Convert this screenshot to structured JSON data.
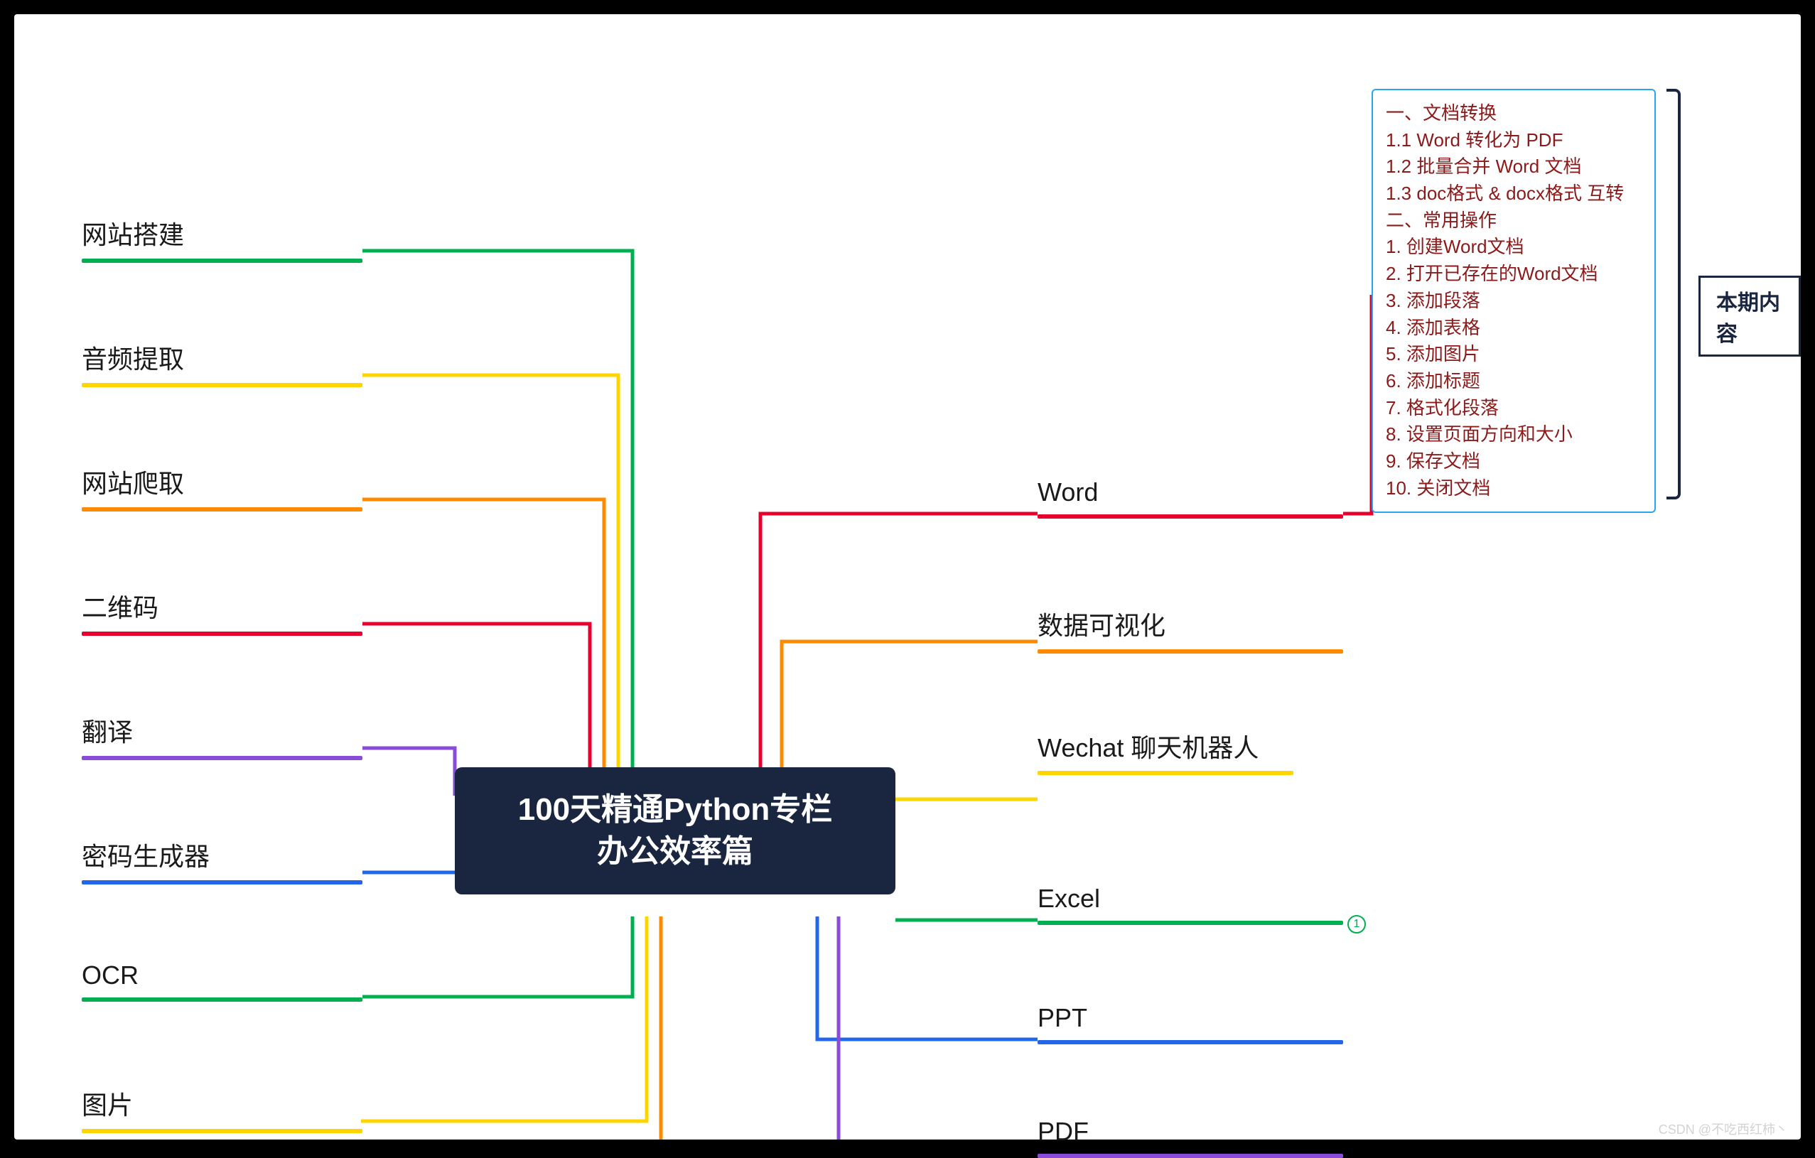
{
  "central": {
    "line1": "100天精通Python专栏",
    "line2": "办公效率篇"
  },
  "left_nodes": [
    {
      "label": "网站搭建",
      "color": "#00b050"
    },
    {
      "label": "音频提取",
      "color": "#ffd500"
    },
    {
      "label": "网站爬取",
      "color": "#ff8a00"
    },
    {
      "label": "二维码",
      "color": "#e6002e"
    },
    {
      "label": "翻译",
      "color": "#8a4bd9"
    },
    {
      "label": "密码生成器",
      "color": "#2366e8"
    },
    {
      "label": "OCR",
      "color": "#00b050"
    },
    {
      "label": "图片",
      "color": "#ffd500"
    }
  ],
  "right_nodes": [
    {
      "label": "Word",
      "color": "#e6002e"
    },
    {
      "label": "数据可视化",
      "color": "#ff8a00"
    },
    {
      "label": "Wechat 聊天机器人",
      "color": "#ffd500",
      "multi": true
    },
    {
      "label": "Excel",
      "color": "#00b050",
      "badge": "1"
    },
    {
      "label": "PPT",
      "color": "#2366e8"
    },
    {
      "label": "PDF",
      "color": "#8a4bd9"
    }
  ],
  "details": [
    "一、文档转换",
    "1.1 Word 转化为 PDF",
    "1.2 批量合并 Word 文档",
    "1.3 doc格式 & docx格式 互转",
    "二、常用操作",
    "1. 创建Word文档",
    "2. 打开已存在的Word文档",
    "3. 添加段落",
    "4. 添加表格",
    "5. 添加图片",
    "6. 添加标题",
    "7. 格式化段落",
    "8. 设置页面方向和大小",
    "9. 保存文档",
    "10. 关闭文档"
  ],
  "issue_label": "本期内容",
  "watermark": "CSDN @不吃西红柿丶"
}
